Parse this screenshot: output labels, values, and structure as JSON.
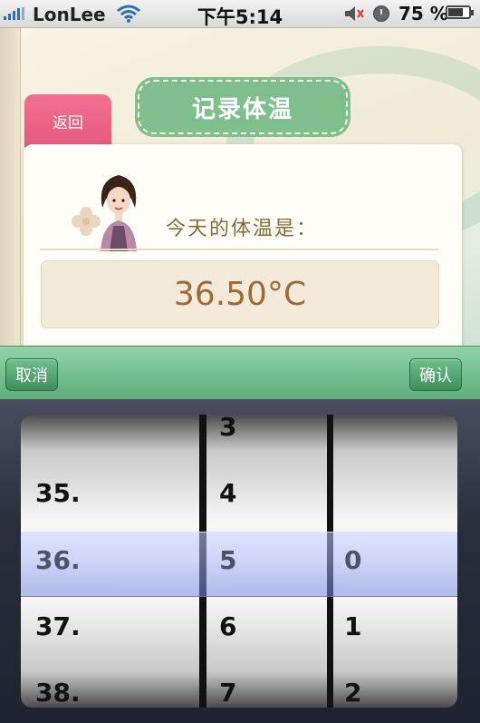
{
  "status_bar": {
    "carrier": "LonLee",
    "time": "下午5:14",
    "battery_percent": "75 %",
    "battery_level": 0.75,
    "icons": [
      "signal-icon",
      "wifi-icon",
      "mute-icon",
      "lock-icon",
      "battery-icon"
    ]
  },
  "header": {
    "back_label": "返回",
    "title": "记录体温"
  },
  "card": {
    "question": "今天的体温是：",
    "value": "36.50°C"
  },
  "toolbar": {
    "cancel_label": "取消",
    "confirm_label": "确认"
  },
  "picker": {
    "wheel_1": [
      "",
      "35.",
      "36.",
      "37.",
      "38."
    ],
    "wheel_2": [
      "3",
      "4",
      "5",
      "6",
      "7"
    ],
    "wheel_3": [
      "",
      "",
      "0",
      "1",
      "2"
    ],
    "selected": {
      "wheel_1": "36.",
      "wheel_2": "5",
      "wheel_3": "0"
    }
  },
  "colors": {
    "accent_green": "#7fbf8e",
    "back_pink": "#e55a7c",
    "value_text": "#a06a36"
  }
}
